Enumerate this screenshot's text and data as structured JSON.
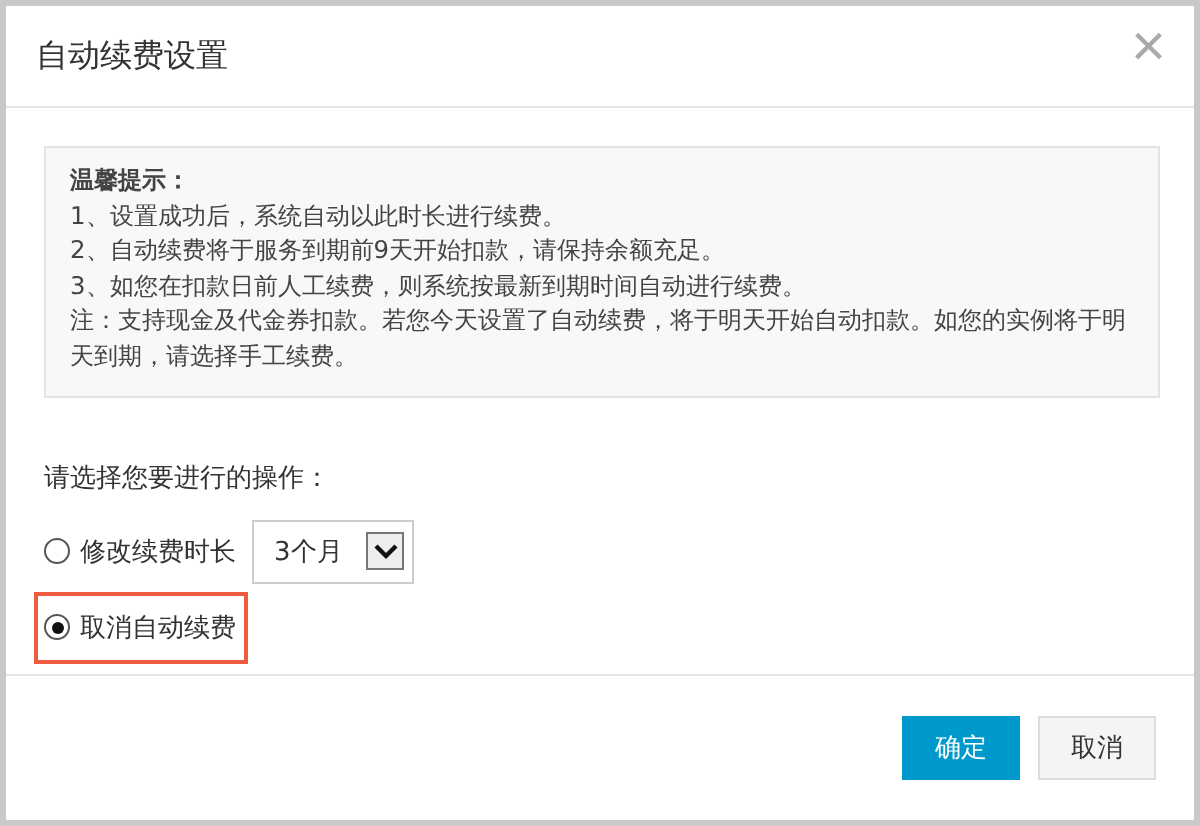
{
  "dialog": {
    "title": "自动续费设置",
    "close": "×"
  },
  "notice": {
    "heading": "温馨提示：",
    "lines": [
      "1、设置成功后，系统自动以此时长进行续费。",
      "2、自动续费将于服务到期前9天开始扣款，请保持余额充足。",
      "3、如您在扣款日前人工续费，则系统按最新到期时间自动进行续费。",
      "注：支持现金及代金券扣款。若您今天设置了自动续费，将于明天开始自动扣款。如您的实例将于明天到期，请选择手工续费。"
    ]
  },
  "prompt": "请选择您要进行的操作：",
  "options": [
    {
      "label": "修改续费时长",
      "selected": false,
      "highlighted": false,
      "kind": "select",
      "select_value": "3个月"
    },
    {
      "label": "取消自动续费",
      "selected": true,
      "highlighted": true,
      "kind": "plain"
    }
  ],
  "buttons": [
    {
      "label": "确定",
      "kind": "primary"
    },
    {
      "label": "取消",
      "kind": "secondary"
    }
  ]
}
